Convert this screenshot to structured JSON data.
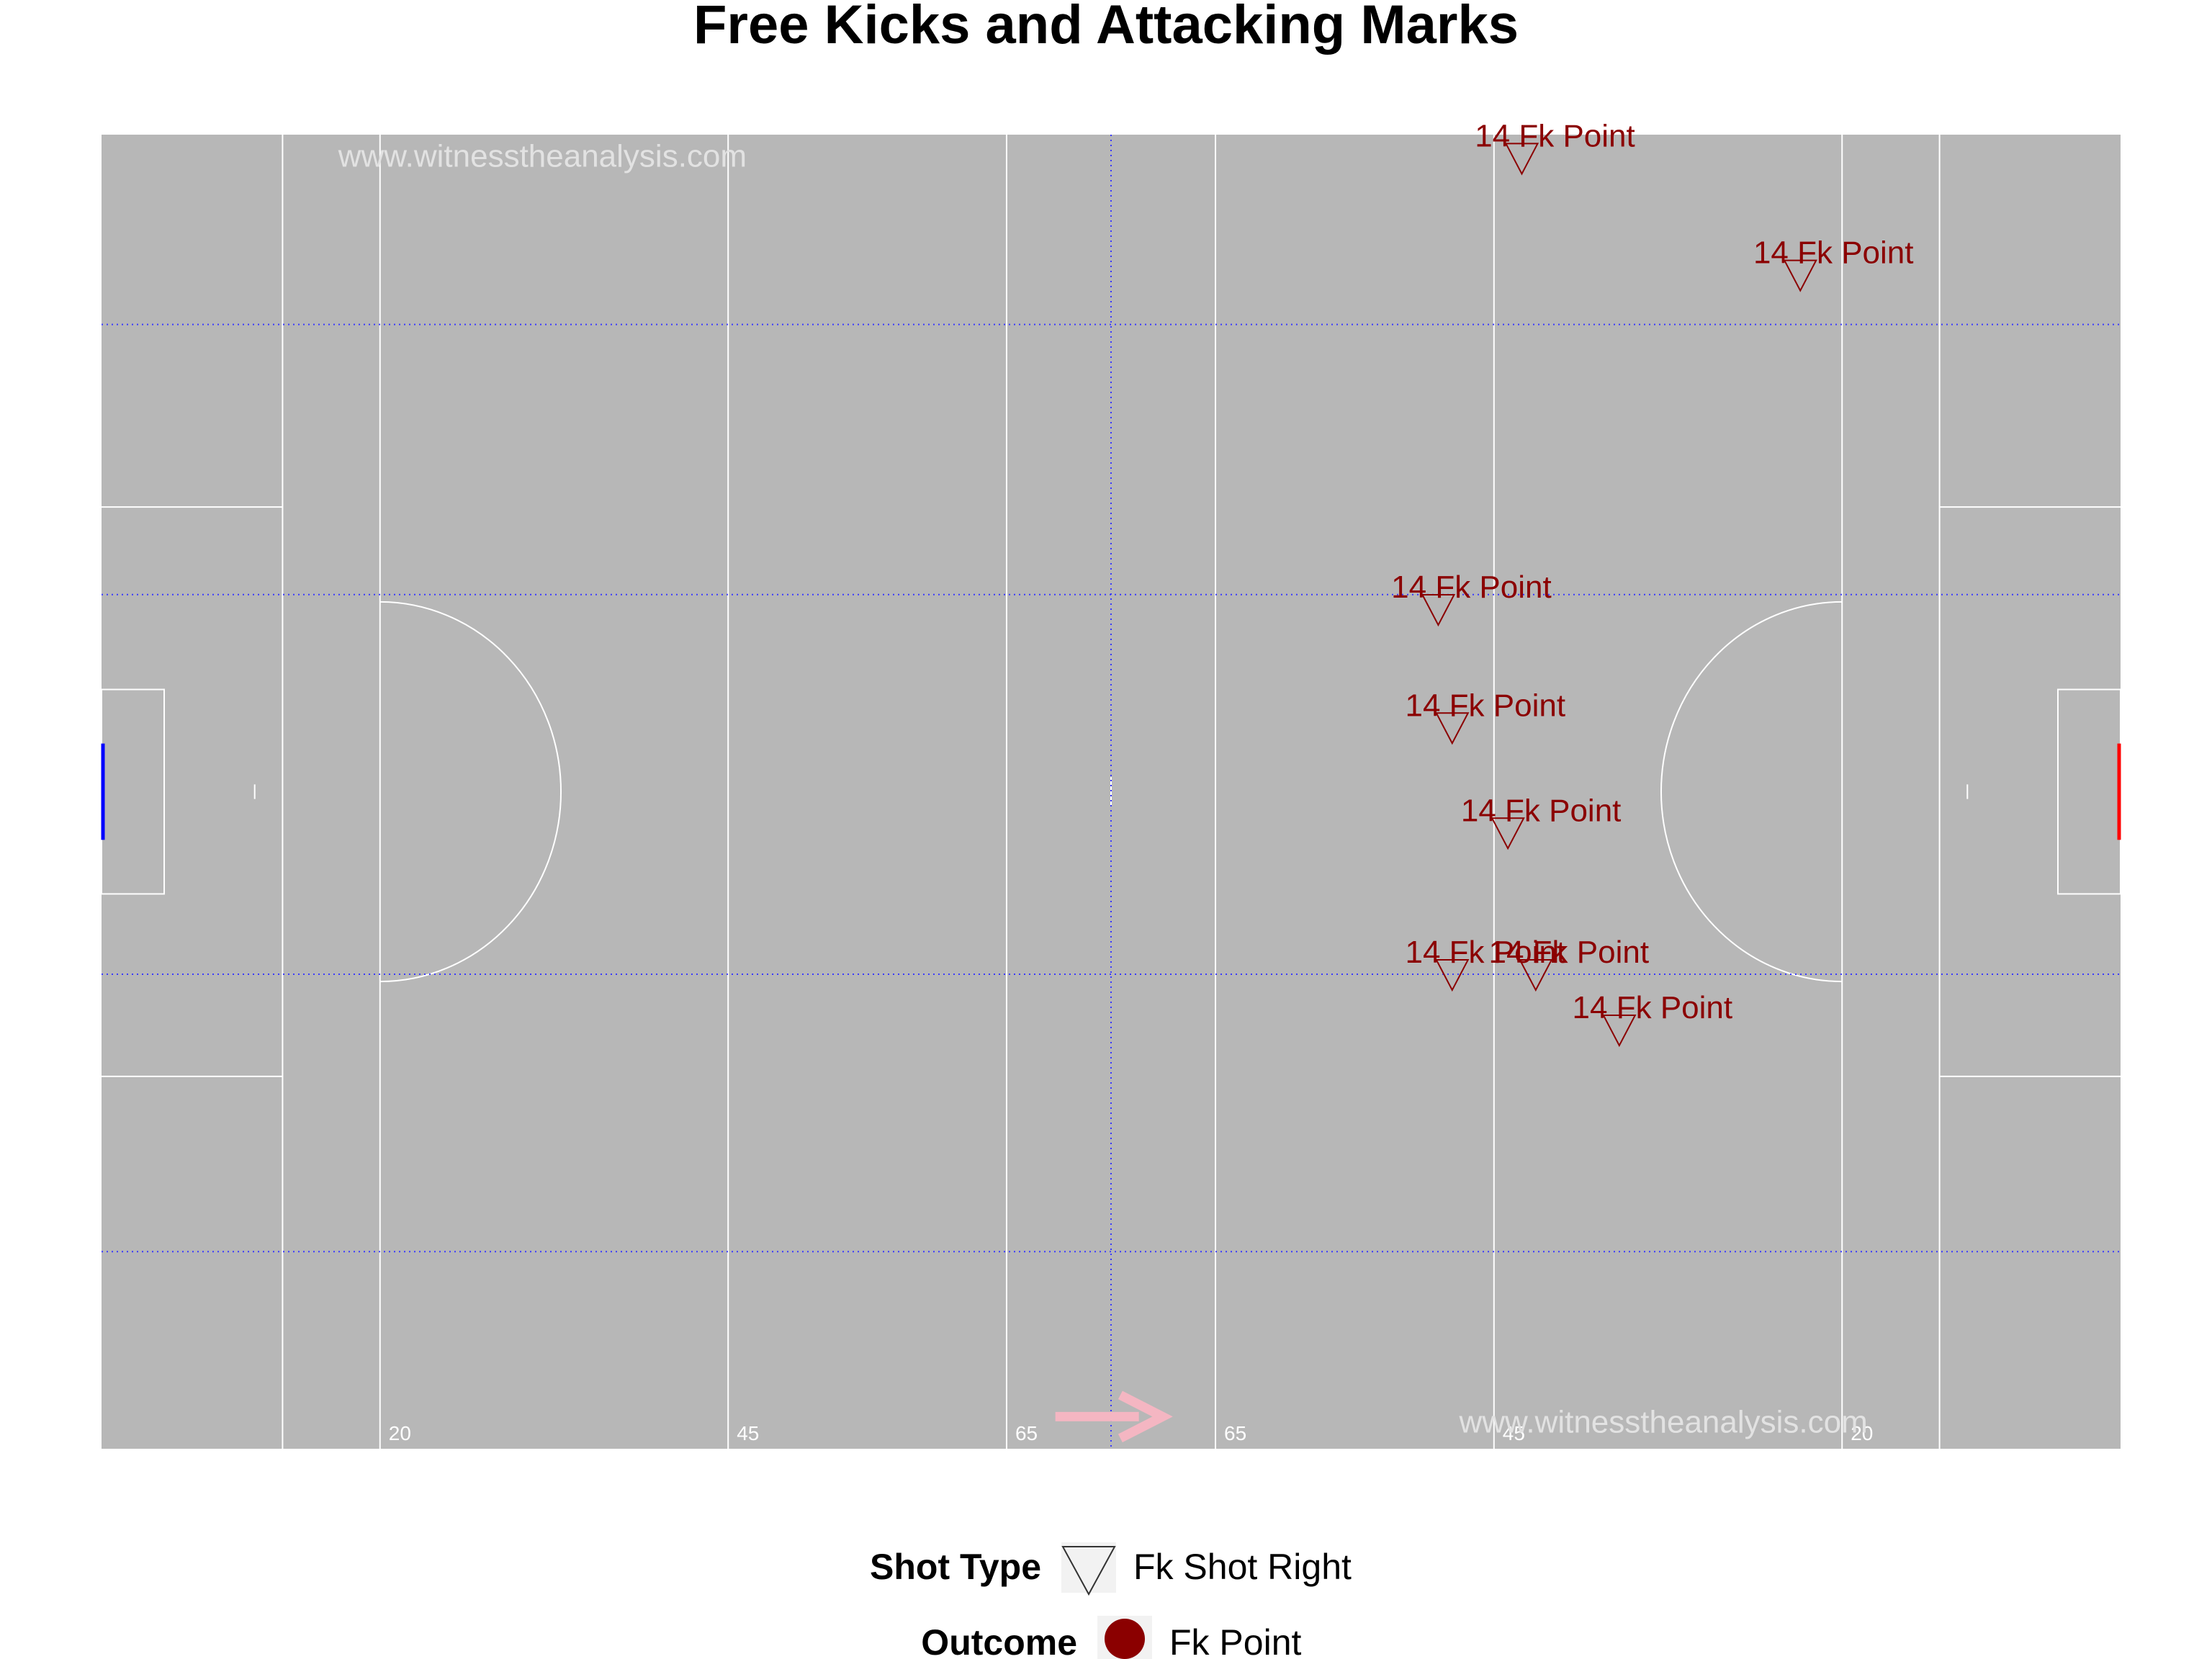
{
  "chart_data": {
    "type": "scatter",
    "title": "Free Kicks and Attacking Marks",
    "watermark": "www.witnesstheanalysis.com",
    "xlim": [
      0,
      145
    ],
    "ylim": [
      0,
      90
    ],
    "yard_labels": [
      {
        "x": 20,
        "text": "20"
      },
      {
        "x": 45,
        "text": "45"
      },
      {
        "x": 65,
        "text": "65"
      },
      {
        "x": 80,
        "text": "65"
      },
      {
        "x": 100,
        "text": "45"
      },
      {
        "x": 125,
        "text": "20"
      }
    ],
    "points": [
      {
        "x": 102,
        "y": 88.5,
        "label": "14 Fk Point"
      },
      {
        "x": 122,
        "y": 80.5,
        "label": "14 Fk Point"
      },
      {
        "x": 96,
        "y": 57.6,
        "label": "14 Fk Point"
      },
      {
        "x": 97,
        "y": 49.5,
        "label": "14 Fk Point"
      },
      {
        "x": 101,
        "y": 42.3,
        "label": "14 Fk Point"
      },
      {
        "x": 97,
        "y": 32.6,
        "label": "14 Fk Point"
      },
      {
        "x": 103,
        "y": 32.6,
        "label": "14 Fk Point"
      },
      {
        "x": 109,
        "y": 28.8,
        "label": "14 Fk Point"
      }
    ],
    "legend": {
      "shot_type_title": "Shot Type",
      "shot_type_label": "Fk Shot Right",
      "outcome_title": "Outcome",
      "outcome_label": "Fk Point"
    },
    "colors": {
      "pitch": "#b7b7b7",
      "lines": "#ffffff",
      "grid": "#3a3aff",
      "marker": "#8b0000",
      "arrow": "#f4b6c2",
      "left_goal": "#0000ff",
      "right_goal": "#ff0000"
    }
  }
}
